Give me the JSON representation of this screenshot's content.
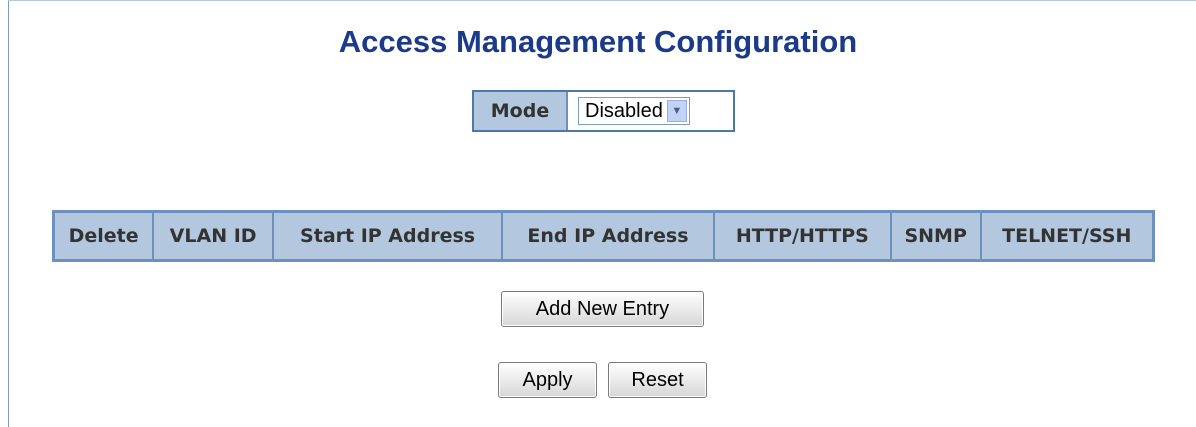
{
  "page": {
    "title": "Access Management Configuration"
  },
  "mode": {
    "label": "Mode",
    "selected": "Disabled"
  },
  "table": {
    "headers": [
      "Delete",
      "VLAN ID",
      "Start IP Address",
      "End IP Address",
      "HTTP/HTTPS",
      "SNMP",
      "TELNET/SSH"
    ],
    "rows": []
  },
  "buttons": {
    "add_new_entry": "Add New Entry",
    "apply": "Apply",
    "reset": "Reset"
  },
  "colors": {
    "title": "#1c3a8a",
    "header_bg": "#b3c8de",
    "border": "#6f8fbf"
  }
}
